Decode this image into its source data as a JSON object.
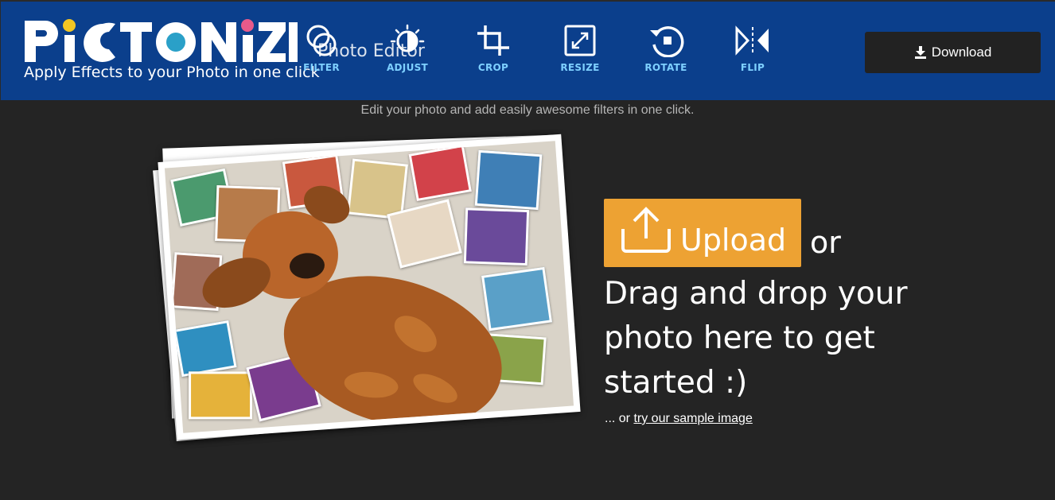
{
  "header": {
    "logo_text": "PICTONIZE",
    "tagline": "Apply Effects to your Photo in one click",
    "ghost_title": "Photo Editor",
    "tools": [
      {
        "label": "FILTER",
        "icon": "filter-icon"
      },
      {
        "label": "ADJUST",
        "icon": "adjust-icon"
      },
      {
        "label": "CROP",
        "icon": "crop-icon"
      },
      {
        "label": "RESIZE",
        "icon": "resize-icon"
      },
      {
        "label": "ROTATE",
        "icon": "rotate-icon"
      },
      {
        "label": "FLIP",
        "icon": "flip-icon"
      }
    ],
    "download_label": "Download",
    "download_icon": "download-icon"
  },
  "main": {
    "subtitle": "Edit your photo and add easily awesome filters in one click.",
    "upload_label": "Upload",
    "upload_icon": "upload-icon",
    "or_text": "or",
    "drag_text": "Drag and drop your photo here to get started :)",
    "sample_prefix": "... or ",
    "sample_link": "try our sample image"
  },
  "colors": {
    "header_bg": "#0b3f8c",
    "page_bg": "#242424",
    "tool_label": "#7ed0ff",
    "upload_bg": "#eda233",
    "download_bg": "#222222"
  }
}
